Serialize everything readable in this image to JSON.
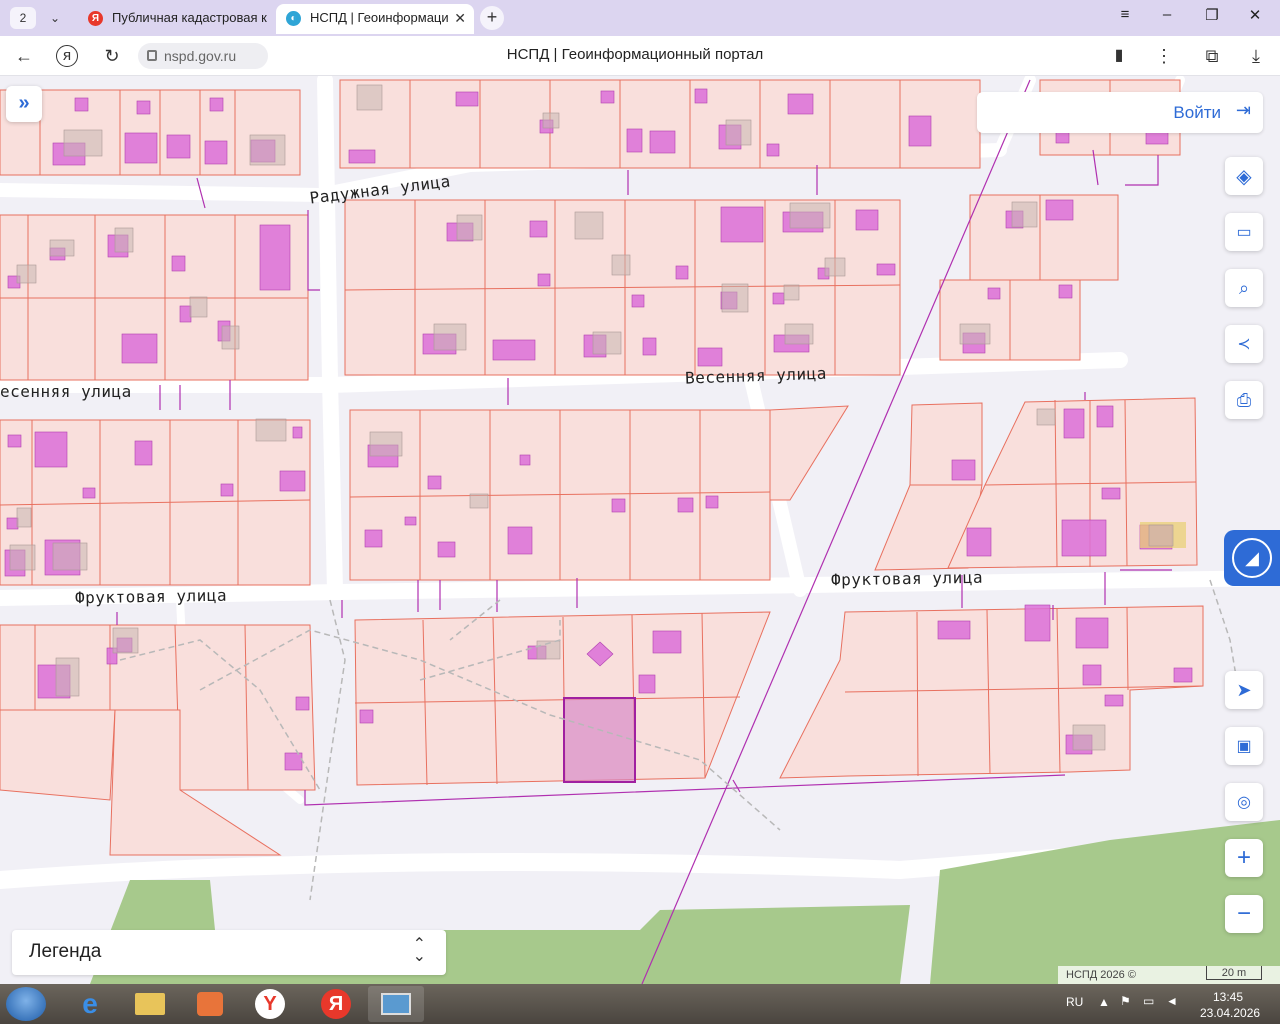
{
  "browser": {
    "tab_count": "2",
    "tabs": [
      {
        "title": "Публичная кадастровая к",
        "favicon": "yandex-icon",
        "active": false
      },
      {
        "title": "НСПД | Геоинформаци",
        "favicon": "nspd-icon",
        "active": true
      }
    ],
    "url": "nspd.gov.ru",
    "page_title": "НСПД | Геоинформационный портал"
  },
  "map": {
    "streets": [
      {
        "name": "Радужная  улица"
      },
      {
        "name": "есенняя  улица"
      },
      {
        "name": "Весенняя  улица"
      },
      {
        "name": "Фруктовая  улица"
      },
      {
        "name": "Фруктовая  улица"
      }
    ],
    "parcel_fill": "#f9dfdc",
    "parcel_stroke": "#e8705f",
    "building_fill": "#dc70d8",
    "selected_parcel_stroke": "#a020a0",
    "green_area": "#a7c98c",
    "road_color": "#ffffff"
  },
  "controls": {
    "login_label": "Войти",
    "legend_label": "Легенда",
    "right_tools": [
      "layers-icon",
      "ruler-icon",
      "search-area-icon",
      "share-icon",
      "print-icon"
    ],
    "nav_tools": [
      "locate-icon",
      "minimap-icon",
      "geo-search-icon"
    ],
    "zoom_in": "+",
    "zoom_out": "−",
    "attribution": "НСПД 2026 ©",
    "scale": "20 m"
  },
  "taskbar": {
    "lang": "RU",
    "time": "13:45",
    "date": "23.04.2026",
    "yandex_label": "Я"
  }
}
